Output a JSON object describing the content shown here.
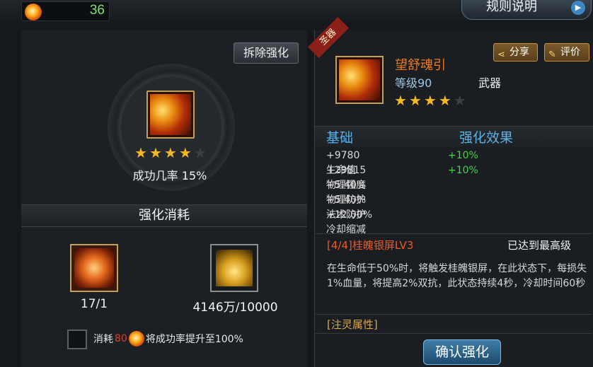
{
  "currency": {
    "icon": "soul-flame-icon",
    "value": "36"
  },
  "rules_button": {
    "label": "规则说明"
  },
  "left": {
    "remove_button": "拆除强化",
    "stars": {
      "filled": 4,
      "total": 5
    },
    "success_rate": "成功几率 15%",
    "cost_title": "强化消耗",
    "materials": [
      {
        "icon": "enhance-stone-icon",
        "count": "17/1"
      },
      {
        "icon": "gold-coins-icon",
        "count": "4146万/10000"
      }
    ],
    "consume_option": {
      "prefix": "消耗",
      "amount": "80",
      "suffix": "将成功率提升至100%"
    }
  },
  "right": {
    "badge": "圣器",
    "item": {
      "name": "望舒魂引",
      "level": "等级90",
      "type": "武器",
      "stars": {
        "filled": 4,
        "total": 5
      }
    },
    "share_button": "分享",
    "review_button": "评价",
    "base_title": "基础",
    "effect_title": "强化效果",
    "stats": [
      {
        "value": "+9780 生命值",
        "bonus": "+10%"
      },
      {
        "value": "+29815 物理强度",
        "bonus": "+10%"
      },
      {
        "value": "+5.40% 物理防护",
        "bonus": ""
      },
      {
        "value": "+5.40% 法术防护",
        "bonus": ""
      },
      {
        "value": "+12.00% 冷却缩减",
        "bonus": ""
      }
    ],
    "skill": {
      "name": "[4/4]桂魄银屏LV3",
      "status": "已达到最高级",
      "description": "在生命低于50%时，将触发桂魄银屏，在此状态下，每损失1%血量，将提高2%双抗，此状态持续4秒，冷却时间60秒"
    },
    "spirit_label": "[注灵属性]",
    "confirm_button": "确认强化"
  },
  "colors": {
    "accent_blue": "#5ab2e8",
    "orange_name": "#f07a1a",
    "green_bonus": "#44d34a",
    "red_skill": "#ea5a26"
  }
}
